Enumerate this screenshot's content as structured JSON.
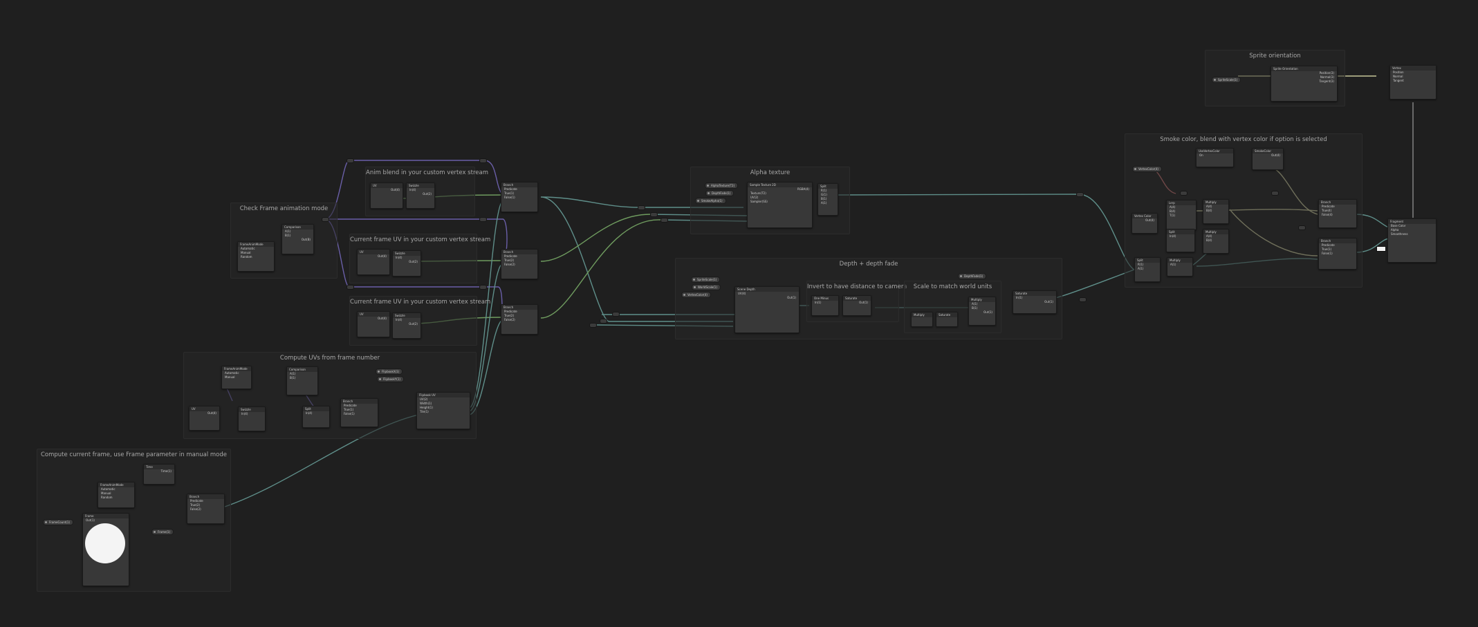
{
  "groups": [
    {
      "id": "check-frame",
      "title": "Check Frame animation mode"
    },
    {
      "id": "anim-blend",
      "title": "Anim blend in your custom vertex stream"
    },
    {
      "id": "uv-stream-1",
      "title": "Current frame UV in your custom vertex stream"
    },
    {
      "id": "uv-stream-2",
      "title": "Current frame UV in your custom vertex stream"
    },
    {
      "id": "compute-uvs",
      "title": "Compute UVs from frame number"
    },
    {
      "id": "compute-frame",
      "title": "Compute current frame, use Frame parameter in manual mode"
    },
    {
      "id": "alpha-texture",
      "title": "Alpha texture"
    },
    {
      "id": "depth-fade",
      "title": "Depth + depth fade"
    },
    {
      "id": "invert-distance",
      "title": "Invert to have distance to camera"
    },
    {
      "id": "scale-world",
      "title": "Scale to match world units"
    },
    {
      "id": "sprite-orientation",
      "title": "Sprite orientation"
    },
    {
      "id": "smoke-color",
      "title": "Smoke color, blend with vertex color if option is selected"
    }
  ],
  "nodes": {
    "frame_anim_keyword": {
      "title": "FrameAnimMode",
      "rows": [
        "Automatic",
        "Manual",
        "Random"
      ]
    },
    "compare": {
      "title": "Comparison",
      "rows": [
        "A(1)",
        "B(1)",
        "Out(B)"
      ]
    },
    "uv_a": {
      "title": "UV",
      "rows": [
        "Out(4)"
      ]
    },
    "swizzle_a": {
      "title": "Swizzle",
      "rows": [
        "In(4)",
        "Out(2)"
      ]
    },
    "uv_b": {
      "title": "UV",
      "rows": [
        "Out(4)"
      ]
    },
    "swizzle_b": {
      "title": "Swizzle",
      "rows": [
        "In(4)",
        "Out(2)"
      ]
    },
    "uv_c": {
      "title": "UV",
      "rows": [
        "Out(4)"
      ]
    },
    "swizzle_c": {
      "title": "Swizzle",
      "rows": [
        "In(4)",
        "Out(2)"
      ]
    },
    "branch_1": {
      "title": "Branch",
      "rows": [
        "Predicate",
        "True(1)",
        "False(1)"
      ]
    },
    "branch_2": {
      "title": "Branch",
      "rows": [
        "Predicate",
        "True(2)",
        "False(2)"
      ]
    },
    "branch_3": {
      "title": "Branch",
      "rows": [
        "Predicate",
        "True(2)",
        "False(2)"
      ]
    },
    "flipbook": {
      "title": "Flipbook UV",
      "rows": [
        "UV(2)",
        "Width(1)",
        "Height(1)",
        "Tile(1)"
      ]
    },
    "frame_mode_sub": {
      "title": "FrameAnimMode",
      "rows": [
        "Automatic",
        "Manual",
        "Random"
      ]
    },
    "time_node": {
      "title": "Time",
      "rows": [
        "Time(1)"
      ]
    },
    "frame_param": {
      "title": "Frame",
      "rows": [
        "Out(1)"
      ]
    },
    "alpha_sample": {
      "title": "Sample Texture 2D",
      "rows": [
        "RGBA(4)",
        "Texture(T2)",
        "UV(2)",
        "Sampler(SS)"
      ]
    },
    "scene_depth": {
      "title": "Scene Depth",
      "rows": [
        "UV(4)",
        "Out(1)"
      ]
    },
    "one_minus": {
      "title": "One Minus",
      "rows": [
        "In(1)",
        "Out(1)"
      ]
    },
    "multiply_depth": {
      "title": "Multiply",
      "rows": [
        "A(1)",
        "B(1)",
        "Out(1)"
      ]
    },
    "saturate": {
      "title": "Saturate",
      "rows": [
        "In(1)",
        "Out(1)"
      ]
    },
    "sprite_orient": {
      "title": "Sprite Orientation",
      "rows": [
        "Position(3)",
        "Normal(3)",
        "Tangent(3)"
      ]
    },
    "vertex_master": {
      "title": "Vertex",
      "rows": [
        "Position",
        "Normal",
        "Tangent"
      ]
    },
    "fragment_master": {
      "title": "Fragment",
      "rows": [
        "Base Color",
        "Alpha",
        "Smoothness"
      ]
    },
    "vertex_color": {
      "title": "Vertex Color",
      "rows": [
        "Out(4)"
      ]
    },
    "lerp": {
      "title": "Lerp",
      "rows": [
        "A(4)",
        "B(4)",
        "T(1)",
        "Out(4)"
      ]
    },
    "multiply_color": {
      "title": "Multiply",
      "rows": [
        "A(4)",
        "B(4)",
        "Out(4)"
      ]
    },
    "split": {
      "title": "Split",
      "rows": [
        "In(4)",
        "R(1)",
        "G(1)",
        "B(1)",
        "A(1)"
      ]
    },
    "use_vtx_kw": {
      "title": "UseVertexColor",
      "rows": [
        "On",
        "Off"
      ]
    },
    "smoke_col": {
      "title": "SmokeColor",
      "rows": [
        "Out(4)"
      ]
    },
    "branch_final_1": {
      "title": "Branch",
      "rows": [
        "Predicate",
        "True(4)",
        "False(4)"
      ]
    },
    "branch_final_2": {
      "title": "Branch",
      "rows": [
        "Predicate",
        "True(1)",
        "False(1)"
      ]
    }
  },
  "pills": {
    "alpha_tex": "AlphaTexture(T2)",
    "depth_fade": "DepthFade(1)",
    "smoke_alpha": "SmokeAlpha(1)",
    "flip_x": "FlipbookX(1)",
    "flip_y": "FlipbookY(1)",
    "frame_pill": "Frame(1)",
    "sprite_scale": "SpriteScale(1)",
    "world_scale": "WorldScale(1)",
    "vtx_color_pill": "VertexColor(4)",
    "frame_count": "FrameCount(1)"
  },
  "colors": {
    "background": "#1f1f1f",
    "wire_vector": "#5f8f8a",
    "wire_uv": "#6f9c5f",
    "wire_bool": "#6a5fa8",
    "wire_color": "#c8c89a",
    "wire_texture": "#c86f6f",
    "wire_grey": "#8a8a8a"
  },
  "icons": {
    "preview": "circle-preview-icon",
    "reroute": "reroute-icon"
  }
}
